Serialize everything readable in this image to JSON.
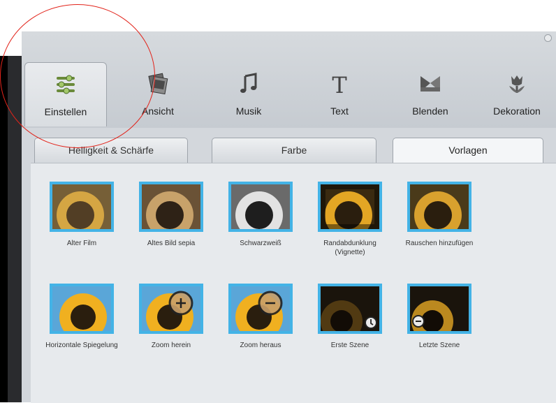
{
  "toolbar": {
    "tools": [
      {
        "label": "Einstellen",
        "icon": "sliders-icon"
      },
      {
        "label": "Ansicht",
        "icon": "photos-icon"
      },
      {
        "label": "Musik",
        "icon": "music-note-icon"
      },
      {
        "label": "Text",
        "icon": "text-t-icon"
      },
      {
        "label": "Blenden",
        "icon": "transition-icon"
      },
      {
        "label": "Dekoration",
        "icon": "tulip-icon"
      }
    ],
    "active": "Einstellen"
  },
  "subtabs": {
    "items": [
      {
        "label": "Helligkeit & Schärfe"
      },
      {
        "label": "Farbe"
      },
      {
        "label": "Vorlagen"
      }
    ],
    "active": "Vorlagen"
  },
  "presets": {
    "row1": [
      {
        "label": "Alter Film"
      },
      {
        "label": "Altes Bild sepia"
      },
      {
        "label": "Schwarzweiß"
      },
      {
        "label": "Randabdunklung (Vignette)"
      },
      {
        "label": "Rauschen hinzufügen"
      }
    ],
    "row2": [
      {
        "label": "Horizontale Spiegelung"
      },
      {
        "label": "Zoom herein"
      },
      {
        "label": "Zoom heraus"
      },
      {
        "label": "Erste Szene"
      },
      {
        "label": "Letzte Szene"
      }
    ]
  },
  "colors": {
    "accent": "#43b3e6",
    "annotation": "#e2231a",
    "panel": "#d3d7dc"
  }
}
